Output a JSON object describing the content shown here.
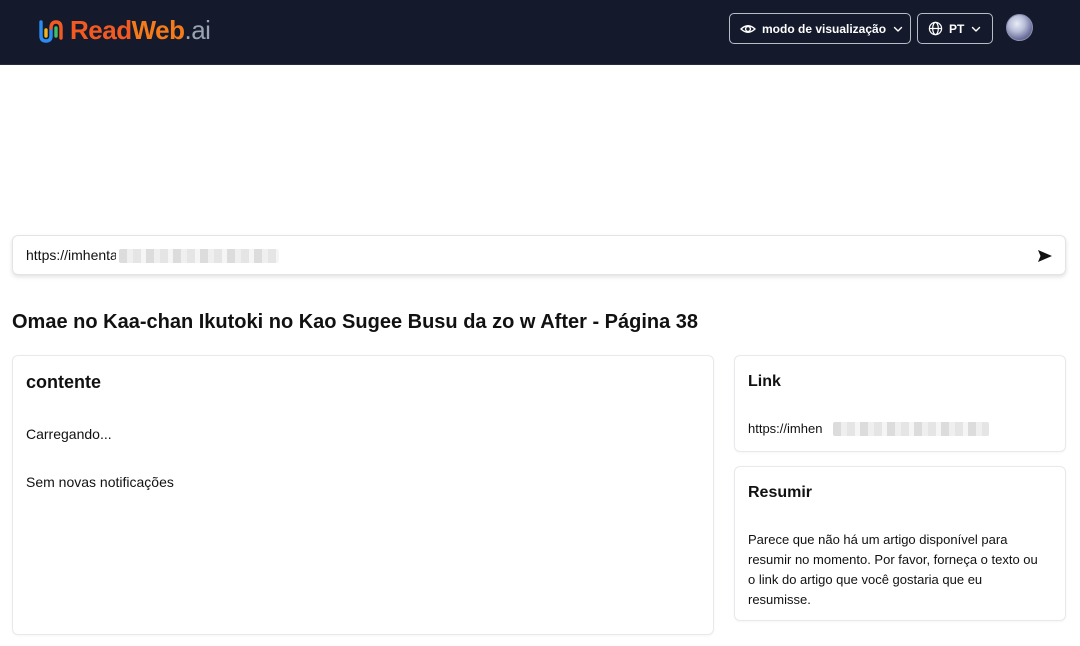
{
  "header": {
    "logo": {
      "read": "Read",
      "web": "Web",
      "ai": ".ai"
    },
    "view_mode_label": "modo de visualização",
    "language_label": "PT",
    "colors": {
      "background": "#141a2b",
      "logo_orange": "#f25a22"
    }
  },
  "url_bar": {
    "value": "https://imhenta"
  },
  "page": {
    "title": "Omae no Kaa-chan Ikutoki no Kao Sugee Busu da zo w After - Página 38"
  },
  "content_card": {
    "title": "contente",
    "loading_text": "Carregando...",
    "notifications_text": "Sem novas notificações"
  },
  "link_card": {
    "title": "Link",
    "url": "https://imhen"
  },
  "summary_card": {
    "title": "Resumir",
    "text": "Parece que não há um artigo disponível para resumir no momento. Por favor, forneça o texto ou o link do artigo que você gostaria que eu resumisse."
  }
}
